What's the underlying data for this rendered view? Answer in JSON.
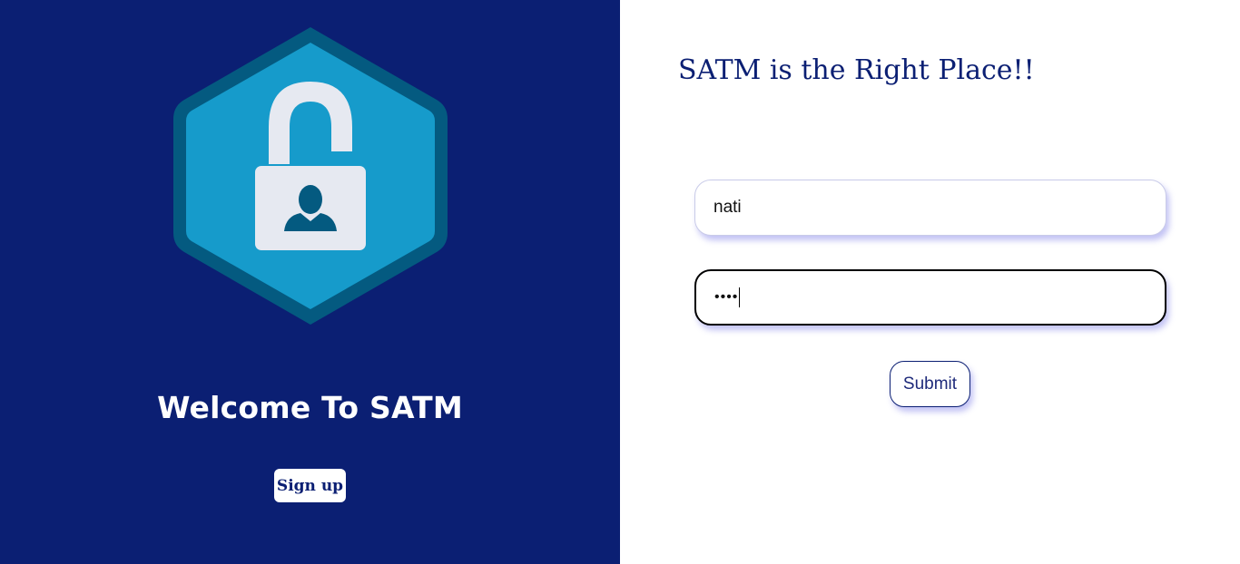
{
  "left_panel": {
    "logo_icon": "unlocked-padlock-user-icon",
    "welcome_title": "Welcome To SATM",
    "signup_label": "Sign up"
  },
  "right_panel": {
    "heading": "SATM is the Right Place!!",
    "username_value": "nati",
    "password_value": "••••",
    "submit_label": "Submit"
  },
  "colors": {
    "navy": "#0b1f73",
    "hexagon_outer": "#045a80",
    "hexagon_inner": "#169bcb",
    "lock_body": "#e6e9f1",
    "input_shadow": "#7878e6"
  }
}
